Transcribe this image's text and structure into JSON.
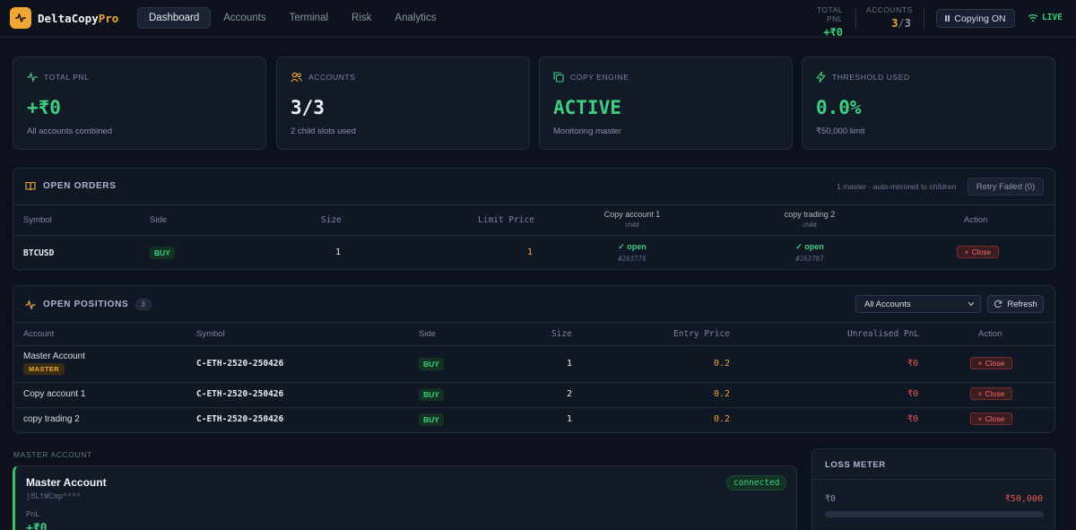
{
  "header": {
    "app_name": "DeltaCopy",
    "app_name_suffix": "Pro",
    "nav": [
      "Dashboard",
      "Accounts",
      "Terminal",
      "Risk",
      "Analytics"
    ],
    "total_pnl_label": "TOTAL PNL",
    "total_pnl_value": "+₹0",
    "accounts_label": "ACCOUNTS",
    "accounts_used": "3",
    "accounts_sep": "/",
    "accounts_total": "3",
    "copying_label": "Copying ON",
    "live_label": "LIVE"
  },
  "cards": [
    {
      "label": "TOTAL PNL",
      "value": "+₹0",
      "sub": "All accounts combined",
      "icon": "pulse-icon",
      "accent": "#3ecf7e"
    },
    {
      "label": "ACCOUNTS",
      "value": "3/3",
      "sub": "2 child slots used",
      "icon": "users-icon",
      "accent": "#f0a733"
    },
    {
      "label": "COPY ENGINE",
      "value": "ACTIVE",
      "sub": "Monitoring master",
      "icon": "copy-icon",
      "accent": "#3ecf7e"
    },
    {
      "label": "THRESHOLD USED",
      "value": "0.0%",
      "sub": "₹50,000 limit",
      "icon": "bolt-icon",
      "accent": "#3ecf7e"
    }
  ],
  "open_orders": {
    "title": "OPEN ORDERS",
    "note": "1 master · auto-mirrored to children",
    "retry_label": "Retry Failed (0)",
    "columns": {
      "symbol": "Symbol",
      "side": "Side",
      "size": "Size",
      "limit_price": "Limit Price",
      "child1": "Copy account 1",
      "child1_sub": "child",
      "child2": "copy trading 2",
      "child2_sub": "child",
      "action": "Action"
    },
    "rows": [
      {
        "symbol": "BTCUSD",
        "side": "BUY",
        "size": "1",
        "limit_price": "1",
        "child1_status": "✓ open",
        "child1_id": "#263770",
        "child2_status": "✓ open",
        "child2_id": "#263787",
        "action": "Close"
      }
    ]
  },
  "open_positions": {
    "title": "OPEN POSITIONS",
    "count": "3",
    "filter_value": "All Accounts",
    "refresh_label": "Refresh",
    "columns": {
      "account": "Account",
      "symbol": "Symbol",
      "side": "Side",
      "size": "Size",
      "entry_price": "Entry Price",
      "unrealised_pnl": "Unrealised PnL",
      "action": "Action"
    },
    "rows": [
      {
        "account": "Master Account",
        "badge": "MASTER",
        "symbol": "C-ETH-2520-250426",
        "side": "BUY",
        "size": "1",
        "entry_price": "0.2",
        "pnl": "₹0",
        "action": "Close"
      },
      {
        "account": "Copy account 1",
        "symbol": "C-ETH-2520-250426",
        "side": "BUY",
        "size": "2",
        "entry_price": "0.2",
        "pnl": "₹0",
        "action": "Close"
      },
      {
        "account": "copy trading 2",
        "symbol": "C-ETH-2520-250426",
        "side": "BUY",
        "size": "1",
        "entry_price": "0.2",
        "pnl": "₹0",
        "action": "Close"
      }
    ]
  },
  "master_section": {
    "label": "MASTER ACCOUNT",
    "name": "Master Account",
    "api_key_masked": "j8LtWCmp****",
    "status": "connected",
    "pnl_label": "PnL",
    "pnl_value": "+₹0"
  },
  "loss_meter": {
    "title": "LOSS METER",
    "current": "₹0",
    "limit": "₹50,000",
    "fraction_used": 0.0
  },
  "colors": {
    "accent": "#f0a733",
    "positive": "#3ecf7e",
    "negative": "#e5574f"
  }
}
